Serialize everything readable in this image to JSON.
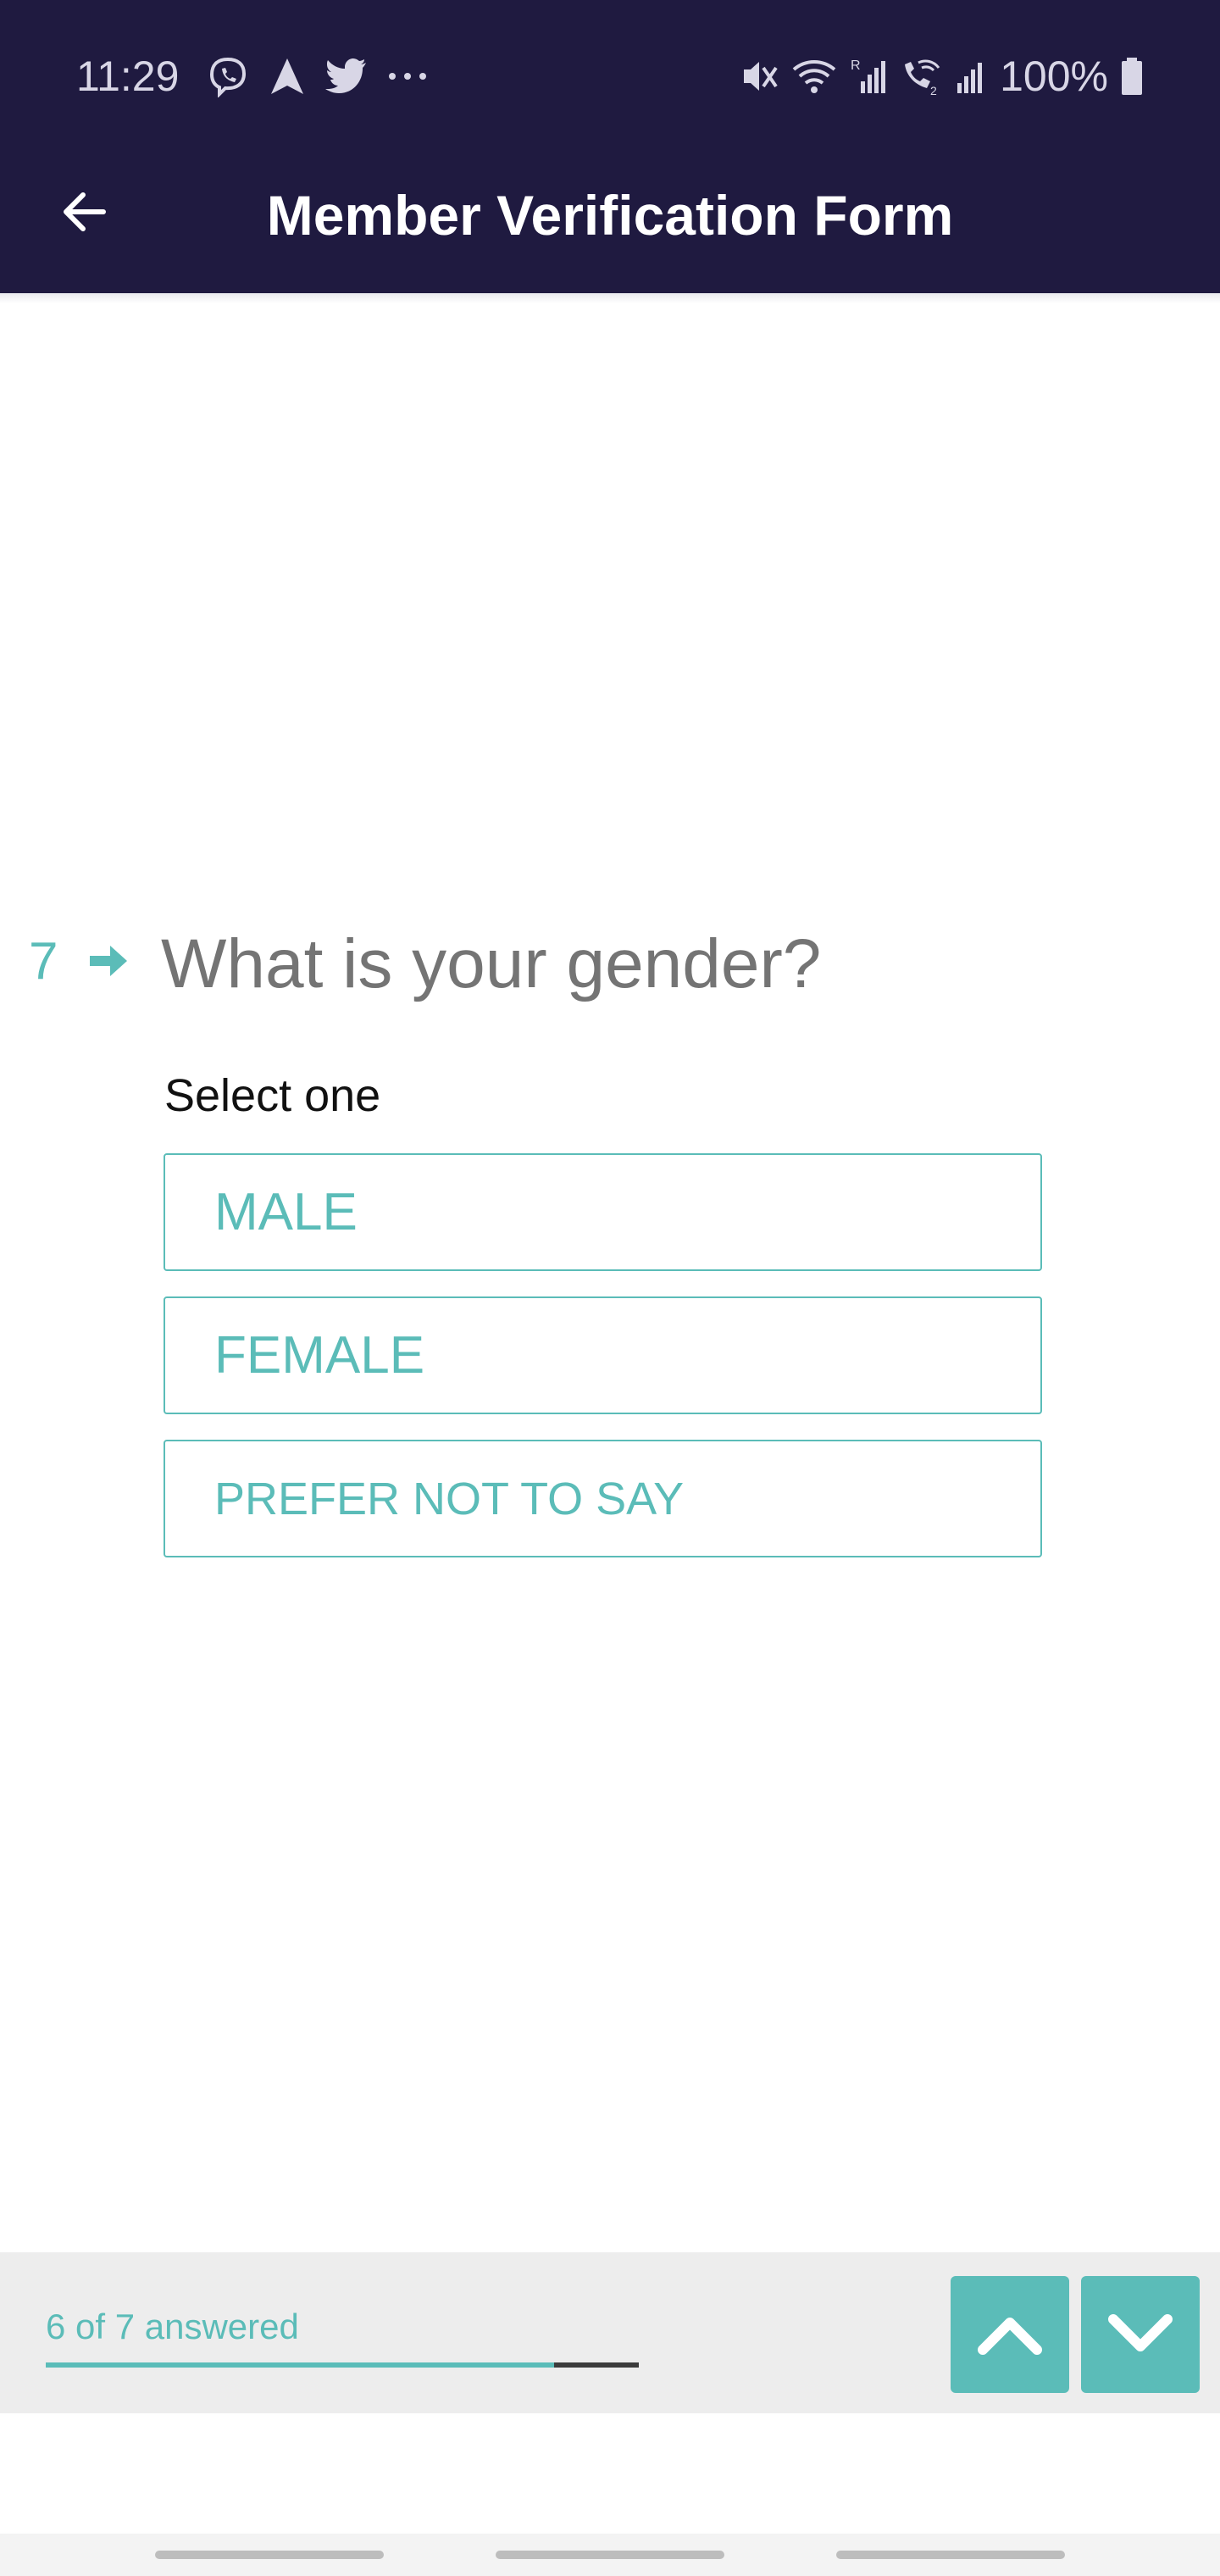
{
  "status_bar": {
    "time": "11:29",
    "battery": "100%",
    "left_icons": [
      "viber-icon",
      "navigation-icon",
      "twitter-icon",
      "more-dots-icon"
    ],
    "right_icons": [
      "mute-icon",
      "wifi-icon",
      "signal-roaming-icon",
      "wifi-calling-icon",
      "signal-icon",
      "battery-icon"
    ]
  },
  "app_bar": {
    "title": "Member Verification Form",
    "back_icon": "arrow-left-icon"
  },
  "question": {
    "number": "7",
    "text": "What is your gender?",
    "hint": "Select one",
    "options": [
      "MALE",
      "FEMALE",
      "PREFER NOT TO SAY"
    ]
  },
  "footer": {
    "progress_text": "6 of 7 answered",
    "answered": 6,
    "total": 7,
    "progress_fraction": 0.857,
    "up_icon": "chevron-up-icon",
    "down_icon": "chevron-down-icon"
  },
  "colors": {
    "header": "#1f1a40",
    "accent": "#5bbcb8",
    "question_text": "#747474",
    "footer_bg": "#ededed"
  }
}
